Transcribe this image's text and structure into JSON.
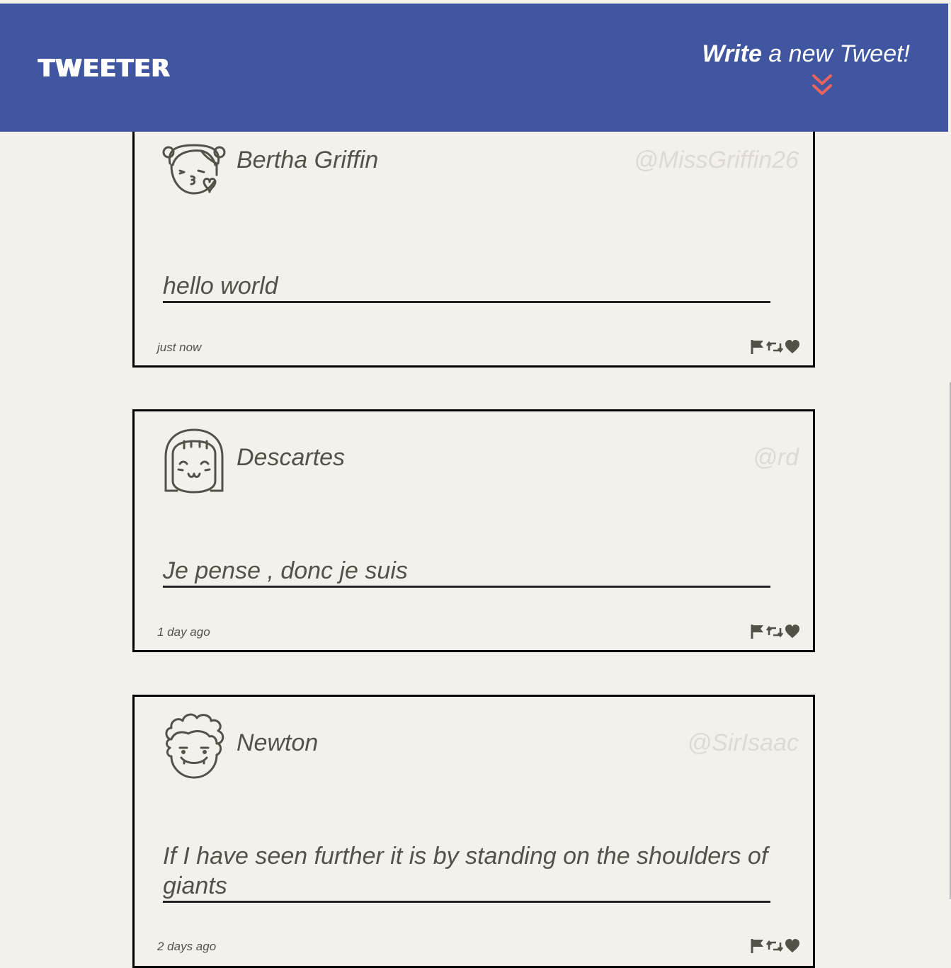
{
  "header": {
    "brand": "TWEETER",
    "compose_strong": "Write",
    "compose_rest": " a new Tweet!"
  },
  "colors": {
    "navbar": "#4056a1",
    "background": "#f4f1ec",
    "accent": "#e8645c",
    "text": "#545149",
    "handle": "#dedad3"
  },
  "tweets": [
    {
      "name": "Bertha Griffin",
      "handle": "@MissGriffin26",
      "content": "hello world",
      "time": "just now",
      "avatar": "kissing-face-avatar"
    },
    {
      "name": "Descartes",
      "handle": "@rd",
      "content": "Je pense , donc je suis",
      "time": "1 day ago",
      "avatar": "bangs-face-avatar"
    },
    {
      "name": "Newton",
      "handle": "@SirIsaac",
      "content": "If I have seen further it is by standing on the shoulders of giants",
      "time": "2 days ago",
      "avatar": "curly-hair-face-avatar"
    }
  ],
  "icons": [
    "flag-icon",
    "retweet-icon",
    "heart-icon",
    "double-chevron-down-icon"
  ]
}
